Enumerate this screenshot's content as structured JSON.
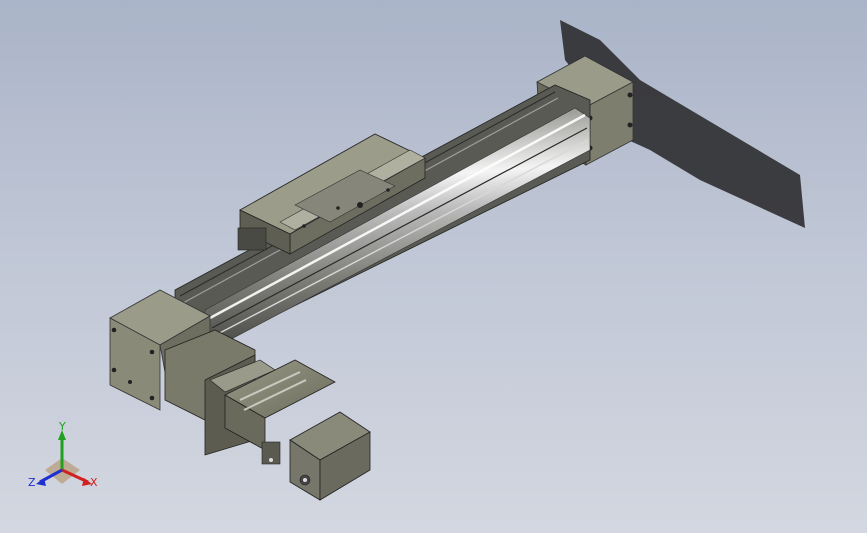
{
  "viewport": {
    "model": "linear-actuator-assembly",
    "colors": {
      "background_top": "#aab4c8",
      "background_bottom": "#d3d7e0",
      "part_gray": "#8a8a78",
      "part_dark": "#3c3c36",
      "rail_highlight": "#f2f2f2",
      "shadow": "#2e2e30"
    }
  },
  "triad": {
    "x_label": "X",
    "y_label": "Y",
    "z_label": "Z",
    "x_color": "#d02020",
    "y_color": "#20a020",
    "z_color": "#2030d0"
  }
}
